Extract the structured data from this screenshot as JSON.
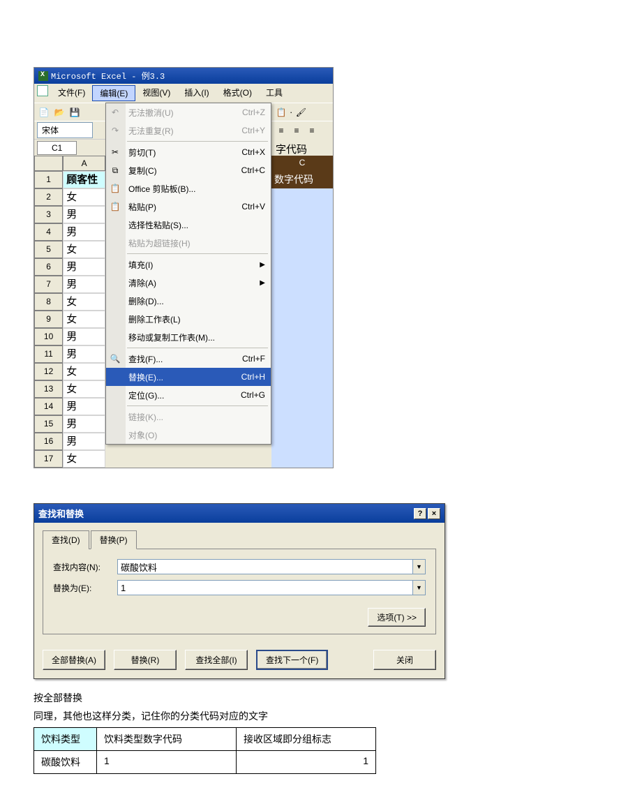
{
  "excel": {
    "title": "Microsoft Excel - 例3.3",
    "menus": {
      "file": "文件(F)",
      "edit": "编辑(E)",
      "view": "视图(V)",
      "insert": "插入(I)",
      "format": "格式(O)",
      "tools": "工具"
    },
    "font_name": "宋体",
    "namebox": "C1",
    "col_a_header": "A",
    "col_a_cell1": "顾客性",
    "col_a_values": [
      "女",
      "男",
      "男",
      "女",
      "男",
      "男",
      "女",
      "女",
      "男",
      "男",
      "女",
      "女",
      "男",
      "男",
      "男",
      "女"
    ],
    "formula_label": "字代码",
    "col_c_header": "数字代码",
    "edit_menu": {
      "undo": "无法撤消(U)",
      "undo_k": "Ctrl+Z",
      "redo": "无法重复(R)",
      "redo_k": "Ctrl+Y",
      "cut": "剪切(T)",
      "cut_k": "Ctrl+X",
      "copy": "复制(C)",
      "copy_k": "Ctrl+C",
      "clipboard": "Office 剪贴板(B)...",
      "paste": "粘贴(P)",
      "paste_k": "Ctrl+V",
      "paste_special": "选择性粘贴(S)...",
      "paste_link": "粘贴为超链接(H)",
      "fill": "填充(I)",
      "clear": "清除(A)",
      "delete": "删除(D)...",
      "delete_sheet": "删除工作表(L)",
      "move_copy": "移动或复制工作表(M)...",
      "find": "查找(F)...",
      "find_k": "Ctrl+F",
      "replace": "替换(E)...",
      "replace_k": "Ctrl+H",
      "goto": "定位(G)...",
      "goto_k": "Ctrl+G",
      "links": "链接(K)...",
      "object": "对象(O)"
    }
  },
  "dialog": {
    "title": "查找和替换",
    "tabs": {
      "find": "查找(D)",
      "replace": "替换(P)"
    },
    "find_label": "查找内容(N):",
    "find_value": "碳酸饮料",
    "replace_label": "替换为(E):",
    "replace_value": "1",
    "options_btn": "选项(T) >>",
    "buttons": {
      "replace_all": "全部替换(A)",
      "replace": "替换(R)",
      "find_all": "查找全部(I)",
      "find_next": "查找下一个(F)",
      "close": "关闭"
    }
  },
  "text": {
    "line1": "按全部替换",
    "line2": "同理，其他也这样分类，记住你的分类代码对应的文字"
  },
  "table": {
    "h1": "饮料类型",
    "h2": "饮料类型数字代码",
    "h3": "接收区域即分组标志",
    "r1c1": "碳酸饮料",
    "r1c2": "1",
    "r1c3": "1"
  }
}
